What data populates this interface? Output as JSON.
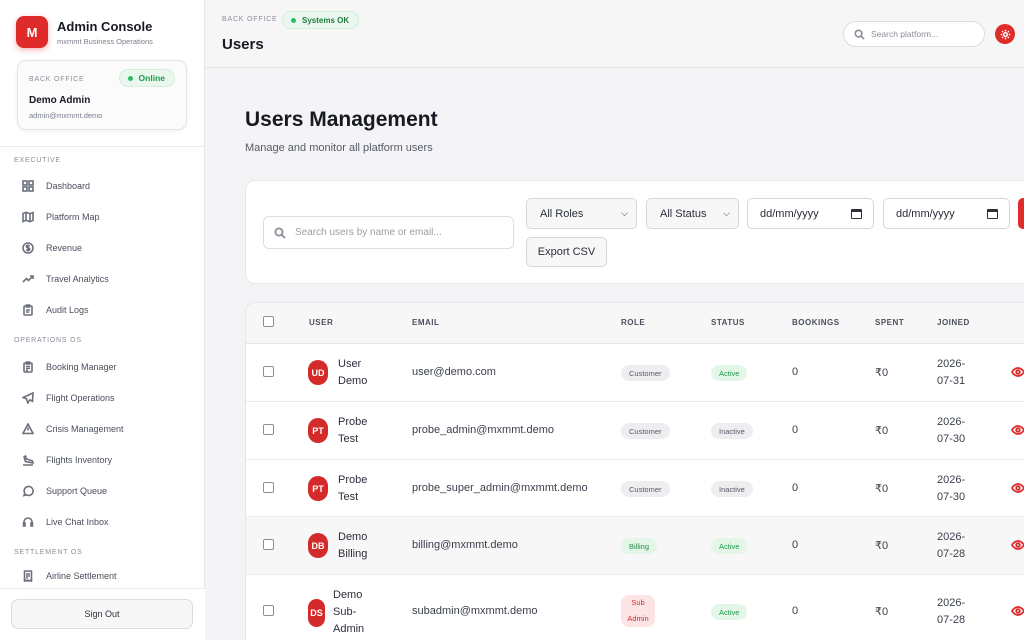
{
  "brand": {
    "logo_letter": "M",
    "title": "Admin Console",
    "subtitle": "mxmmt Business Operations"
  },
  "profile": {
    "label": "BACK OFFICE",
    "status": "Online",
    "name": "Demo Admin",
    "email": "admin@mxmmt.demo"
  },
  "sidebar": {
    "sections": [
      "EXECUTIVE",
      "OPERATIONS OS",
      "SETTLEMENT OS"
    ],
    "items": [
      {
        "label": "Dashboard",
        "icon": "grid-icon"
      },
      {
        "label": "Platform Map",
        "icon": "map-icon"
      },
      {
        "label": "Revenue",
        "icon": "dollar-icon"
      },
      {
        "label": "Travel Analytics",
        "icon": "trending-up-icon"
      },
      {
        "label": "Audit Logs",
        "icon": "clipboard-icon"
      },
      {
        "label": "Booking Manager",
        "icon": "clipboard-list-icon"
      },
      {
        "label": "Flight Operations",
        "icon": "plane-icon"
      },
      {
        "label": "Crisis Management",
        "icon": "alert-triangle-icon"
      },
      {
        "label": "Flights Inventory",
        "icon": "plane-landing-icon"
      },
      {
        "label": "Support Queue",
        "icon": "message-circle-icon"
      },
      {
        "label": "Live Chat Inbox",
        "icon": "headset-icon"
      },
      {
        "label": "Airline Settlement",
        "icon": "receipt-icon"
      }
    ],
    "signout": "Sign Out"
  },
  "topbar": {
    "label": "BACK OFFICE",
    "status": "Systems OK",
    "title": "Users",
    "search_placeholder": "Search platform..."
  },
  "main": {
    "title": "Users Management",
    "subtitle": "Manage and monitor all platform users"
  },
  "filters": {
    "search_placeholder": "Search users by name or email...",
    "role": "All Roles",
    "status": "All Status",
    "date_from": "dd/mm/yyyy",
    "date_to": "dd/mm/yyyy",
    "export": "Export CSV"
  },
  "table": {
    "columns": [
      "USER",
      "EMAIL",
      "ROLE",
      "STATUS",
      "BOOKINGS",
      "SPENT",
      "JOINED"
    ],
    "rows": [
      {
        "initials": "UD",
        "name": "User Demo",
        "email": "user@demo.com",
        "role": "Customer",
        "status": "Active",
        "bookings": "0",
        "spent": "₹0",
        "joined": "2026-07-31"
      },
      {
        "initials": "PT",
        "name": "Probe Test",
        "email": "probe_admin@mxmmt.demo",
        "role": "Customer",
        "status": "Inactive",
        "bookings": "0",
        "spent": "₹0",
        "joined": "2026-07-30"
      },
      {
        "initials": "PT",
        "name": "Probe Test",
        "email": "probe_super_admin@mxmmt.demo",
        "role": "Customer",
        "status": "Inactive",
        "bookings": "0",
        "spent": "₹0",
        "joined": "2026-07-30"
      },
      {
        "initials": "DB",
        "name": "Demo Billing",
        "email": "billing@mxmmt.demo",
        "role": "Billing",
        "status": "Active",
        "bookings": "0",
        "spent": "₹0",
        "joined": "2026-07-28"
      },
      {
        "initials": "DS",
        "name": "Demo Sub-Admin",
        "email": "subadmin@mxmmt.demo",
        "role": "Sub Admin",
        "status": "Active",
        "bookings": "0",
        "spent": "₹0",
        "joined": "2026-07-28"
      }
    ]
  },
  "colors": {
    "accent": "#e02b2b",
    "success": "#1f9a4b"
  }
}
